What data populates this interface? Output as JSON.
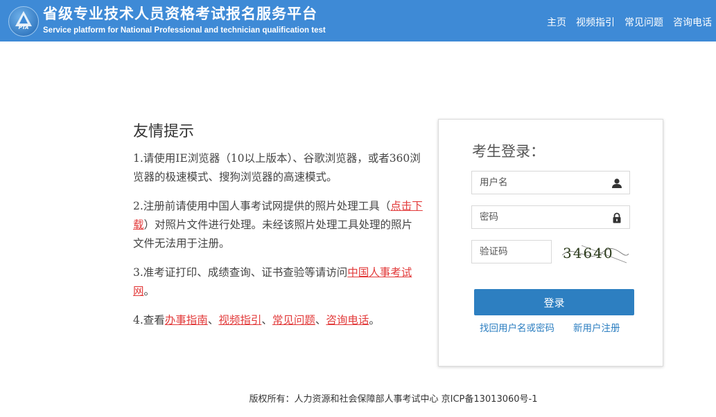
{
  "header": {
    "logo_text": "PTA",
    "title": "省级专业技术人员资格考试报名服务平台",
    "subtitle": "Service platform for National Professional and technician qualification test",
    "nav": [
      "主页",
      "视频指引",
      "常见问题",
      "咨询电话"
    ]
  },
  "tips": {
    "heading": "友情提示",
    "item1": "1.请使用IE浏览器（10以上版本）、谷歌浏览器，或者360浏览器的极速模式、搜狗浏览器的高速模式。",
    "item2_pre": "2.注册前请使用中国人事考试网提供的照片处理工具（",
    "item2_link": "点击下载",
    "item2_post": "）对照片文件进行处理。未经该照片处理工具处理的照片文件无法用于注册。",
    "item3_pre": "3.准考证打印、成绩查询、证书查验等请访问",
    "item3_link": "中国人事考试网",
    "item3_post": "。",
    "item4_pre": "4.查看",
    "item4_links": [
      "办事指南",
      "视频指引",
      "常见问题",
      "咨询电话"
    ],
    "item4_sep": "、",
    "item4_post": "。"
  },
  "login": {
    "title": "考生登录：",
    "username_placeholder": "用户名",
    "password_placeholder": "密码",
    "captcha_placeholder": "验证码",
    "captcha_text": "34640",
    "submit_label": "登录",
    "recover_link": "找回用户名或密码",
    "register_link": "新用户注册"
  },
  "footer": {
    "copyright": "版权所有：人力资源和社会保障部人事考试中心 京ICP备13013060号-1"
  },
  "colors": {
    "header_bg": "#3e8ad6",
    "button_bg": "#2d7fc1",
    "link_red": "#e23a3a",
    "link_blue": "#2d7fc1"
  }
}
